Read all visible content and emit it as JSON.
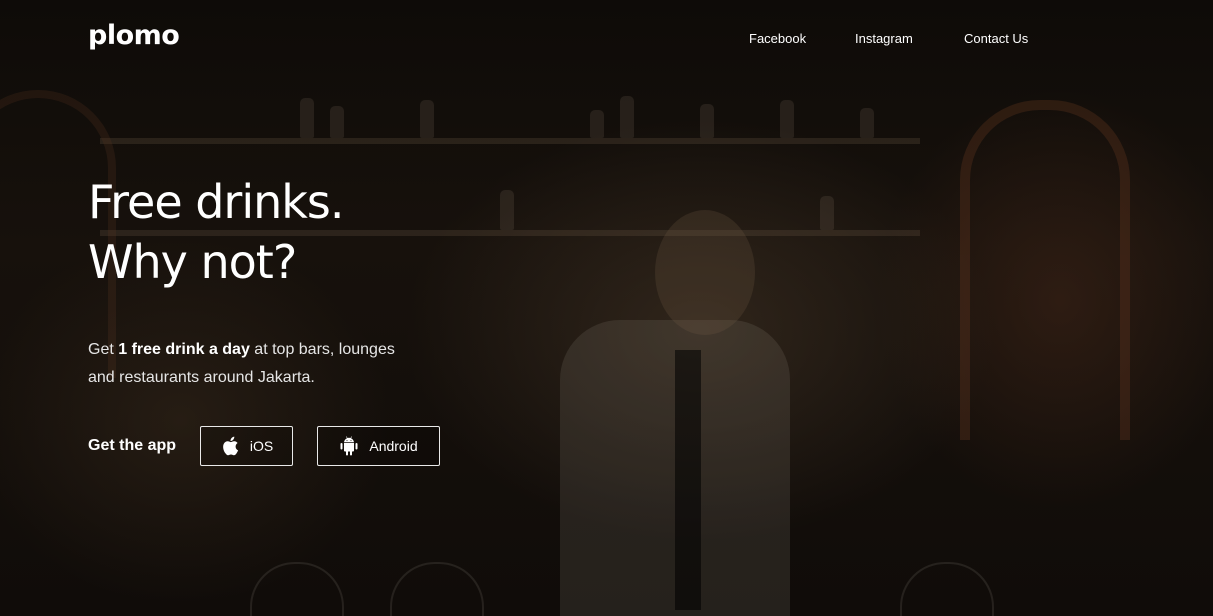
{
  "brand": {
    "logo_text": "plomo"
  },
  "nav": {
    "items": [
      {
        "label": "Facebook"
      },
      {
        "label": "Instagram"
      },
      {
        "label": "Contact Us"
      }
    ]
  },
  "hero": {
    "headline_line1": "Free drinks.",
    "headline_line2": "Why not?",
    "tagline_prefix": "Get ",
    "tagline_bold": "1 free drink a day",
    "tagline_suffix": " at top bars, lounges",
    "tagline_line2": "and restaurants around Jakarta."
  },
  "cta": {
    "label": "Get the app",
    "ios_label": "iOS",
    "ios_icon": "apple-icon",
    "android_label": "Android",
    "android_icon": "android-icon"
  },
  "colors": {
    "text": "#ffffff",
    "background": "#0b0806",
    "button_border": "#e9e9e9"
  }
}
